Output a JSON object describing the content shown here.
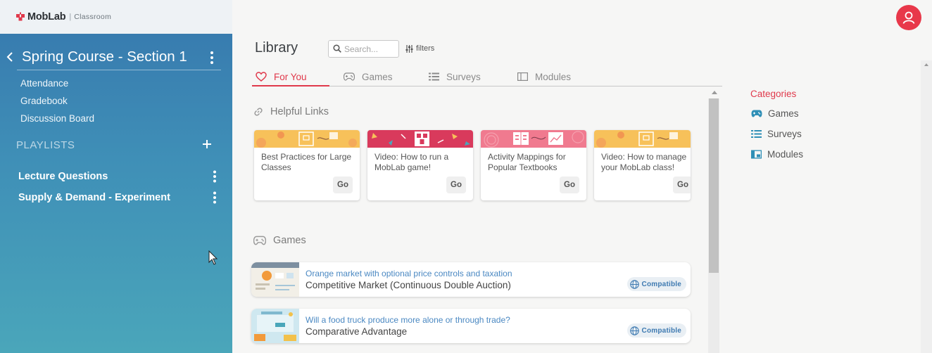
{
  "brand": {
    "name": "MobLab",
    "separator": "|",
    "product": "Classroom",
    "accent": "#e0394b"
  },
  "course": {
    "title": "Spring Course - Section 1"
  },
  "nav": [
    {
      "label": "Attendance"
    },
    {
      "label": "Gradebook"
    },
    {
      "label": "Discussion Board"
    }
  ],
  "playlists": {
    "label": "PLAYLISTS",
    "items": [
      {
        "label": "Lecture Questions"
      },
      {
        "label": "Supply & Demand - Experiment"
      }
    ]
  },
  "library": {
    "title": "Library",
    "search_placeholder": "Search...",
    "filters_label": "filters",
    "tabs": [
      {
        "label": "For You",
        "icon": "heart-icon",
        "active": true
      },
      {
        "label": "Games",
        "icon": "gamepad-icon"
      },
      {
        "label": "Surveys",
        "icon": "list-icon"
      },
      {
        "label": "Modules",
        "icon": "module-icon"
      }
    ]
  },
  "helpful_links": {
    "label": "Helpful Links",
    "cards": [
      {
        "title": "Best Practices for Large Classes",
        "button": "Go",
        "banner_color": "#f7c15a"
      },
      {
        "title": "Video: How to run a MobLab game!",
        "button": "Go",
        "banner_color": "#d93a5c"
      },
      {
        "title": "Activity Mappings for Popular Textbooks",
        "button": "Go",
        "banner_color": "#f07a8f"
      },
      {
        "title": "Video: How to manage your MobLab class!",
        "button": "Go",
        "banner_color": "#f7c15a"
      }
    ]
  },
  "games": {
    "label": "Games",
    "items": [
      {
        "description": "Orange market with optional price controls and taxation",
        "title": "Competitive Market (Continuous Double Auction)",
        "badge": "Compatible"
      },
      {
        "description": "Will a food truck produce more alone or through trade?",
        "title": "Comparative Advantage",
        "badge": "Compatible"
      }
    ]
  },
  "categories": {
    "label": "Categories",
    "items": [
      {
        "label": "Games",
        "icon": "gamepad-icon"
      },
      {
        "label": "Surveys",
        "icon": "list-icon"
      },
      {
        "label": "Modules",
        "icon": "module-icon"
      }
    ]
  }
}
